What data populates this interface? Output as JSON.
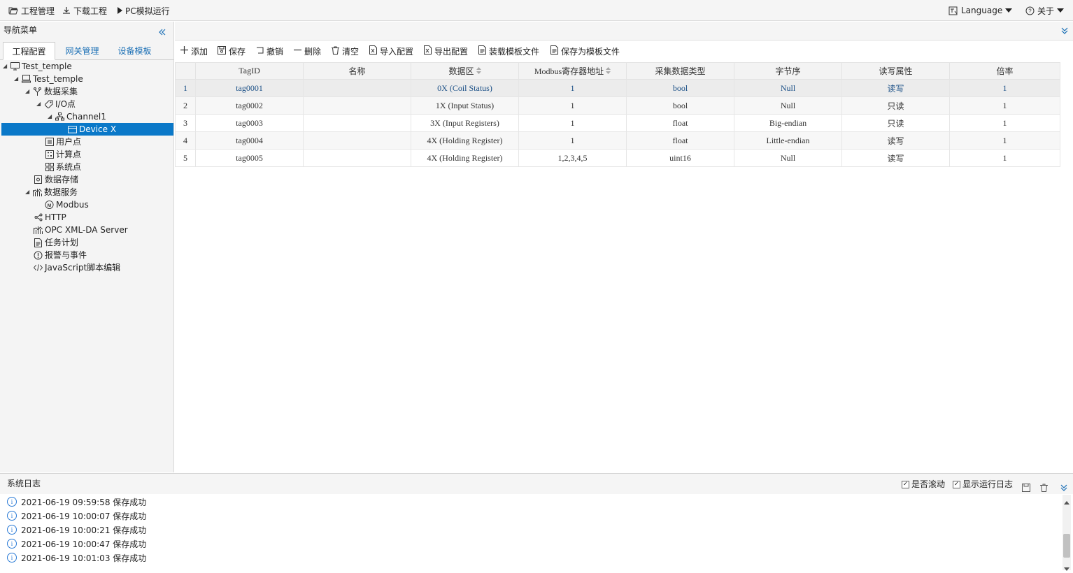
{
  "topbar": {
    "project_mgmt": "工程管理",
    "download": "下载工程",
    "pc_run": "PC模拟运行",
    "language": "Language",
    "about": "关于"
  },
  "sidebar": {
    "title": "导航菜单",
    "tabs": [
      "工程配置",
      "网关管理",
      "设备模板"
    ],
    "tree": [
      {
        "label": "Test_temple",
        "icon": "monitor-icon"
      },
      {
        "label": "Test_temple",
        "icon": "computer-icon"
      },
      {
        "label": "数据采集",
        "icon": "branch-icon"
      },
      {
        "label": "I/O点",
        "icon": "tag-icon"
      },
      {
        "label": "Channel1",
        "icon": "network-icon"
      },
      {
        "label": "Device X",
        "icon": "device-icon"
      },
      {
        "label": "用户点",
        "icon": "list-icon"
      },
      {
        "label": "计算点",
        "icon": "calc-icon"
      },
      {
        "label": "系统点",
        "icon": "grid-icon"
      },
      {
        "label": "数据存储",
        "icon": "storage-icon"
      },
      {
        "label": "数据服务",
        "icon": "chart-icon"
      },
      {
        "label": "Modbus",
        "icon": "modbus-icon"
      },
      {
        "label": "HTTP",
        "icon": "share-icon"
      },
      {
        "label": "OPC XML-DA Server",
        "icon": "chart-icon"
      },
      {
        "label": "任务计划",
        "icon": "file-icon"
      },
      {
        "label": "报警与事件",
        "icon": "alert-icon"
      },
      {
        "label": "JavaScript脚本编辑",
        "icon": "code-icon"
      }
    ]
  },
  "toolbar": {
    "add": "添加",
    "save": "保存",
    "undo": "撤销",
    "delete": "删除",
    "clear": "清空",
    "import": "导入配置",
    "export": "导出配置",
    "load_template": "装载模板文件",
    "save_template": "保存为模板文件"
  },
  "table": {
    "columns": [
      "TagID",
      "名称",
      "数据区",
      "Modbus寄存器地址",
      "采集数据类型",
      "字节序",
      "读写属性",
      "倍率"
    ],
    "rows": [
      {
        "no": "1",
        "tagid": "tag0001",
        "name": "",
        "area": "0X (Coil Status)",
        "addr": "1",
        "type": "bool",
        "order": "Null",
        "rw": "读写",
        "rate": "1"
      },
      {
        "no": "2",
        "tagid": "tag0002",
        "name": "",
        "area": "1X (Input Status)",
        "addr": "1",
        "type": "bool",
        "order": "Null",
        "rw": "只读",
        "rate": "1"
      },
      {
        "no": "3",
        "tagid": "tag0003",
        "name": "",
        "area": "3X (Input Registers)",
        "addr": "1",
        "type": "float",
        "order": "Big-endian",
        "rw": "只读",
        "rate": "1"
      },
      {
        "no": "4",
        "tagid": "tag0004",
        "name": "",
        "area": "4X (Holding Register)",
        "addr": "1",
        "type": "float",
        "order": "Little-endian",
        "rw": "读写",
        "rate": "1"
      },
      {
        "no": "5",
        "tagid": "tag0005",
        "name": "",
        "area": "4X (Holding Register)",
        "addr": "1,2,3,4,5",
        "type": "uint16",
        "order": "Null",
        "rw": "读写",
        "rate": "1"
      }
    ]
  },
  "log": {
    "title": "系统日志",
    "auto_scroll": "是否滚动",
    "show_run_log": "显示运行日志",
    "lines": [
      "2021-06-19 09:59:58 保存成功",
      "2021-06-19 10:00:07 保存成功",
      "2021-06-19 10:00:21 保存成功",
      "2021-06-19 10:00:47 保存成功",
      "2021-06-19 10:01:03 保存成功"
    ]
  },
  "colors": {
    "accent": "#0a78c8",
    "link": "#1a6fb5"
  }
}
